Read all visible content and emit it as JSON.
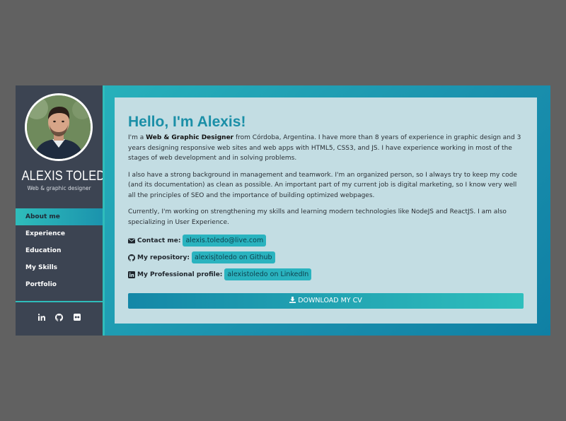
{
  "sidebar": {
    "name": "ALEXIS TOLEDO",
    "subtitle": "Web & graphic designer",
    "nav": [
      "About me",
      "Experience",
      "Education",
      "My Skills",
      "Portfolio"
    ],
    "active_index": 0,
    "social_icons": [
      "linkedin-icon",
      "github-icon",
      "flickr-icon"
    ]
  },
  "main": {
    "heading": "Hello, I'm Alexis!",
    "intro": {
      "prefix": "I'm a ",
      "bold": "Web & Graphic Designer",
      "suffix": " from Córdoba, Argentina. I have more than 8 years of experience in graphic design and 3 years designing responsive web sites and web apps with HTML5, CSS3, and JS. I have experience working in most of the stages of web development and in solving problems."
    },
    "paragraph2": "I also have a strong background in management and teamwork. I'm an organized person, so I always try to keep my code (and its documentation) as clean as possible. An important part of my current job is digital marketing, so I know very well all the principles of SEO and the importance of building optimized webpages.",
    "paragraph3": "Currently, I'm working on strengthening my skills and learning modern technologies like NodeJS and ReactJS. I am also specializing in User Experience.",
    "contacts": [
      {
        "label": "Contact me:",
        "value": "alexis.toledo@live.com",
        "icon": "envelope-icon"
      },
      {
        "label": "My repository:",
        "value": "alexisjtoledo on Github",
        "icon": "github-icon"
      },
      {
        "label": "My Professional profile:",
        "value": "alexistoledo on LinkedIn",
        "icon": "linkedin-icon"
      }
    ],
    "download_label": "DOWNLOAD MY CV"
  },
  "colors": {
    "page_bg": "#616161",
    "sidebar_bg": "#3c4452",
    "accent": "#2fbdbb",
    "accent_dark": "#1b8fa7",
    "content_bg": "#c3dde3"
  }
}
